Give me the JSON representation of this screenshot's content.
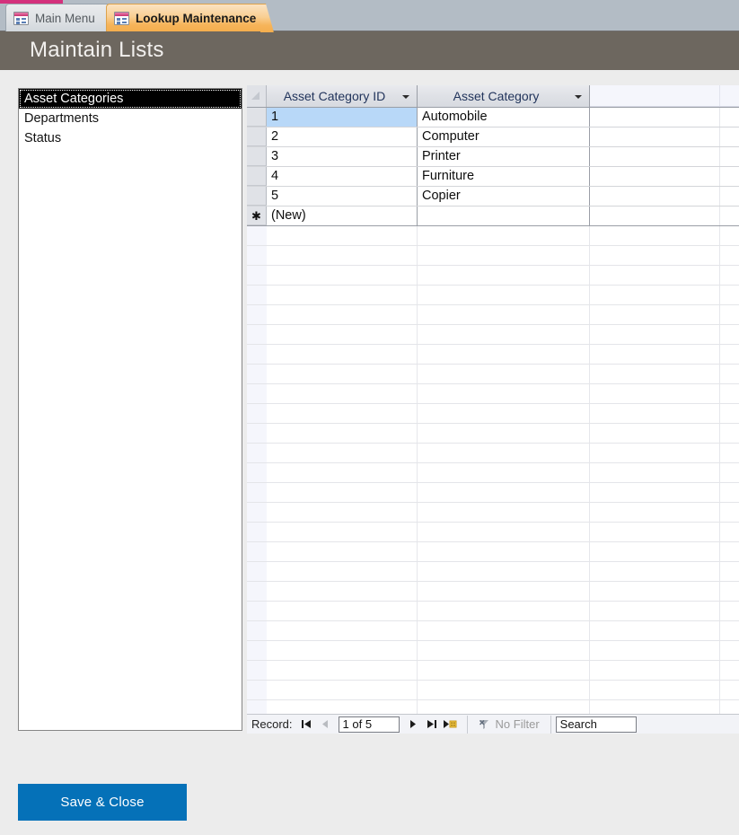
{
  "window": {
    "tabs": [
      {
        "label": "Main Menu",
        "icon": "form-icon",
        "active": false
      },
      {
        "label": "Lookup Maintenance",
        "icon": "form-icon",
        "active": true
      }
    ]
  },
  "header": {
    "title": "Maintain Lists",
    "bg_color": "#6d675f",
    "text_color": "#f2f0ee"
  },
  "list_box": {
    "items": [
      {
        "label": "Asset Categories",
        "selected": true
      },
      {
        "label": "Departments",
        "selected": false
      },
      {
        "label": "Status",
        "selected": false
      }
    ]
  },
  "datasheet": {
    "columns": [
      {
        "label": "Asset Category ID",
        "sort_icon": "chevron-down-icon"
      },
      {
        "label": "Asset Category",
        "sort_icon": "chevron-down-icon"
      }
    ],
    "rows": [
      {
        "selector": "",
        "id": "1",
        "category": "Automobile",
        "selected": true
      },
      {
        "selector": "",
        "id": "2",
        "category": "Computer",
        "selected": false
      },
      {
        "selector": "",
        "id": "3",
        "category": "Printer",
        "selected": false
      },
      {
        "selector": "",
        "id": "4",
        "category": "Furniture",
        "selected": false
      },
      {
        "selector": "",
        "id": "5",
        "category": "Copier",
        "selected": false
      },
      {
        "selector": "✱",
        "id": "(New)",
        "category": "",
        "selected": false,
        "is_new": true
      }
    ],
    "selection_color": "#b8d8f8"
  },
  "nav_bar": {
    "record_label": "Record:",
    "first_button": "first-record-icon",
    "prev_button": "previous-record-icon",
    "record_value": "1 of 5",
    "next_button": "next-record-icon",
    "last_button": "last-record-icon",
    "new_button": "new-record-icon",
    "filter_label": "No Filter",
    "filter_icon": "filter-off-icon",
    "search_value": "Search"
  },
  "footer": {
    "save_close_label": "Save & Close",
    "save_close_color": "#0571b8"
  }
}
